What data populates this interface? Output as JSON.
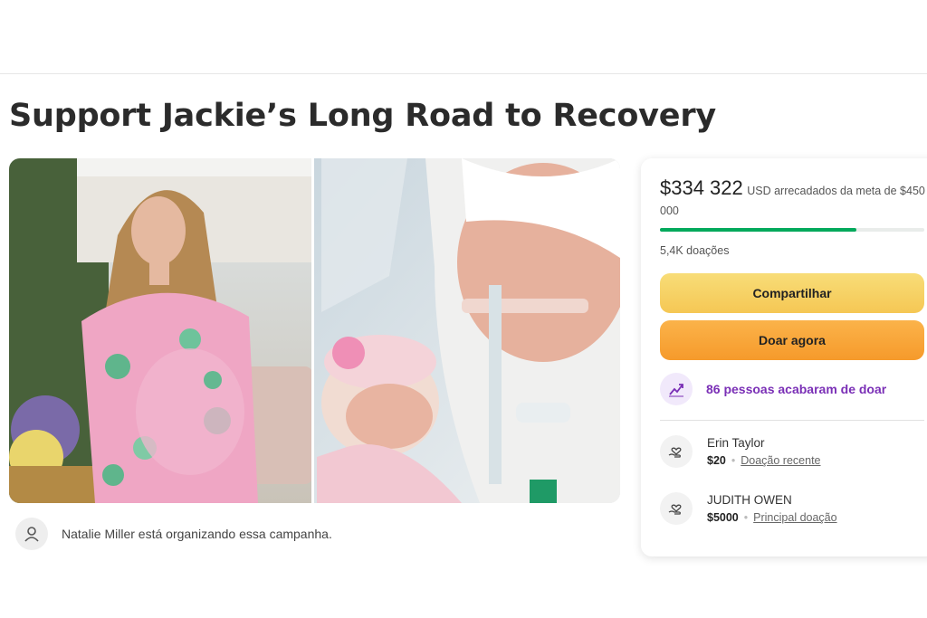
{
  "page": {
    "title": "Support Jackie’s Long Road to Recovery"
  },
  "organizer": {
    "text": "Natalie Miller está organizando essa campanha.",
    "icon": "user-icon"
  },
  "campaign": {
    "raised": "$334 322",
    "raised_suffix": "USD arrecadados da meta de $450 000",
    "progress_fraction": 0.743,
    "donations_count": "5,4K doações",
    "share_label": "Compartilhar",
    "donate_label": "Doar agora",
    "recent_donors_text": "86 pessoas acabaram de doar",
    "colors": {
      "progress": "#02a95c",
      "share_button": "#f6d062",
      "donate_button": "#f8a83a",
      "recent_text": "#7a2fb6"
    }
  },
  "donors": [
    {
      "name": "Erin Taylor",
      "amount": "$20",
      "tag": "Doação recente",
      "icon": "donation-hand-heart-icon"
    },
    {
      "name": "JUDITH OWEN",
      "amount": "$5000",
      "tag": "Principal doação",
      "icon": "donation-hand-heart-icon"
    }
  ]
}
